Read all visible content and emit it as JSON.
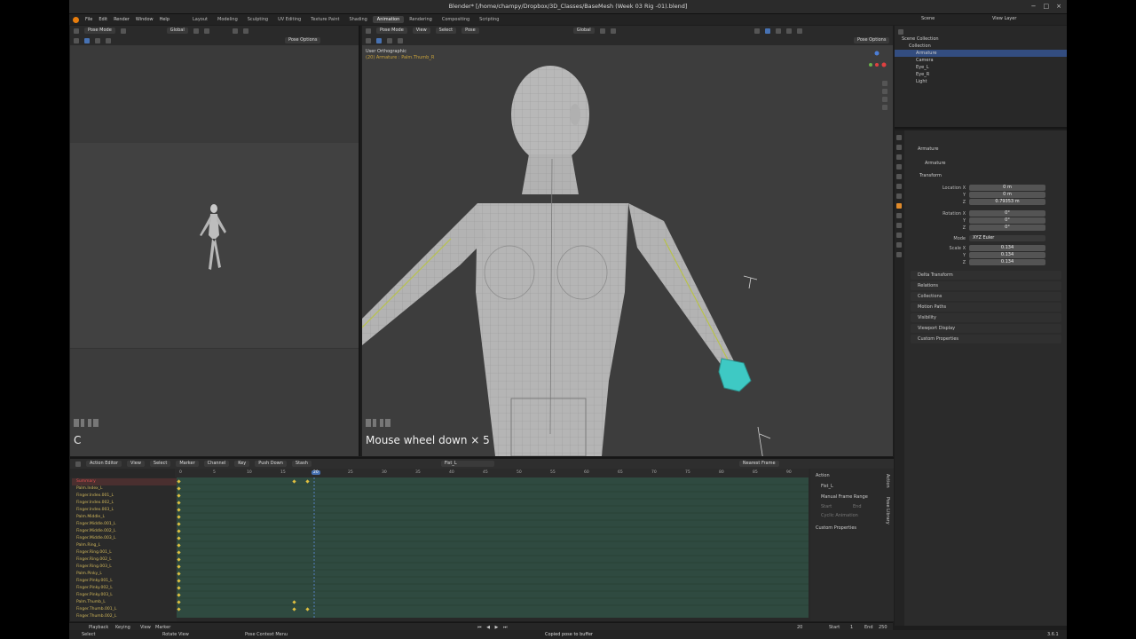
{
  "window": {
    "title": "Blender* [/home/champy/Dropbox/3D_Classes/BaseMesh (Week 03 Rig -01).blend]",
    "controls": [
      "−",
      "□",
      "×"
    ]
  },
  "menu": {
    "items": [
      "File",
      "Edit",
      "Render",
      "Window",
      "Help"
    ],
    "workspaces": [
      "Layout",
      "Modeling",
      "Sculpting",
      "UV Editing",
      "Texture Paint",
      "Shading",
      "Animation",
      "Rendering",
      "Compositing",
      "Scripting"
    ],
    "active_workspace": "Animation",
    "scene": "Scene",
    "view_layer": "View Layer"
  },
  "left_viewport": {
    "mode": "Pose Mode",
    "orientation": "Global",
    "options": "Pose Options",
    "key_hint": "C"
  },
  "main_viewport": {
    "mode": "Pose Mode",
    "menus": [
      "View",
      "Select",
      "Pose"
    ],
    "orientation": "Global",
    "options": "Pose Options",
    "view_name": "User Orthographic",
    "object_info": "(20) Armature : Palm.Thumb_R",
    "key_hint": "Mouse wheel down × 5"
  },
  "outliner": {
    "root": "Scene Collection",
    "collection": "Collection",
    "items": [
      "Armature",
      "Camera",
      "Eye_L",
      "Eye_R",
      "Light"
    ],
    "selected": "Armature"
  },
  "properties": {
    "object_name": "Armature",
    "data_name": "Armature",
    "transform_label": "Transform",
    "location": {
      "label": "Location X",
      "x": "0 m",
      "y": "0 m",
      "z": "0.79353 m"
    },
    "rotation": {
      "label": "Rotation X",
      "x": "0°",
      "y": "0°",
      "z": "0°"
    },
    "mode_label": "Mode",
    "mode_value": "XYZ Euler",
    "scale": {
      "label": "Scale X",
      "x": "0.134",
      "y": "0.134",
      "z": "0.134"
    },
    "axis_y": "Y",
    "axis_z": "Z",
    "sections": [
      "Delta Transform",
      "Relations",
      "Collections",
      "Motion Paths",
      "Visibility",
      "Viewport Display",
      "Custom Properties"
    ]
  },
  "action_editor": {
    "editor": "Action Editor",
    "menus": [
      "View",
      "Select",
      "Marker",
      "Channel",
      "Key"
    ],
    "push_down": "Push Down",
    "stash": "Stash",
    "action_name": "Fist_L",
    "snapping": "Nearest Frame",
    "current_frame": "20",
    "ruler": [
      "0",
      "5",
      "10",
      "15",
      "20",
      "25",
      "30",
      "35",
      "40",
      "45",
      "50",
      "55",
      "60",
      "65",
      "70",
      "75",
      "80",
      "85",
      "90"
    ],
    "channels": [
      "Summary",
      "Palm.Index_L",
      "Finger.Index.001_L",
      "Finger.Index.002_L",
      "Finger.Index.003_L",
      "Palm.Middle_L",
      "Finger.Middle.001_L",
      "Finger.Middle.002_L",
      "Finger.Middle.003_L",
      "Palm.Ring_L",
      "Finger.Ring.001_L",
      "Finger.Ring.002_L",
      "Finger.Ring.003_L",
      "Palm.Pinky_L",
      "Finger.Pinky.001_L",
      "Finger.Pinky.002_L",
      "Finger.Pinky.003_L",
      "Palm.Thumb_L",
      "Finger.Thumb.001_L",
      "Finger.Thumb.002_L"
    ],
    "side_panel": {
      "action_header": "Action",
      "action_name": "Fist_L",
      "manual_range": "Manual Frame Range",
      "start": "Start",
      "end": "End",
      "cyclic": "Cyclic Animation",
      "custom": "Custom Properties",
      "tabs": [
        "Action",
        "Pose Library"
      ]
    }
  },
  "timeline": {
    "menus": [
      "Playback",
      "Keying",
      "View",
      "Marker"
    ],
    "frame": "20",
    "start_label": "Start",
    "start": "1",
    "end_label": "End",
    "end": "250"
  },
  "status": {
    "left": "Select",
    "middle1": "Rotate View",
    "middle2": "Pose Context Menu",
    "message": "Copied pose to buffer",
    "version": "3.6.1"
  },
  "colors": {
    "accent": "#4772b3",
    "bone_text": "#d2b85b",
    "keyframe": "#e0c040",
    "playhead": "#5680c2",
    "selected_mesh": "#3ec9c4"
  }
}
